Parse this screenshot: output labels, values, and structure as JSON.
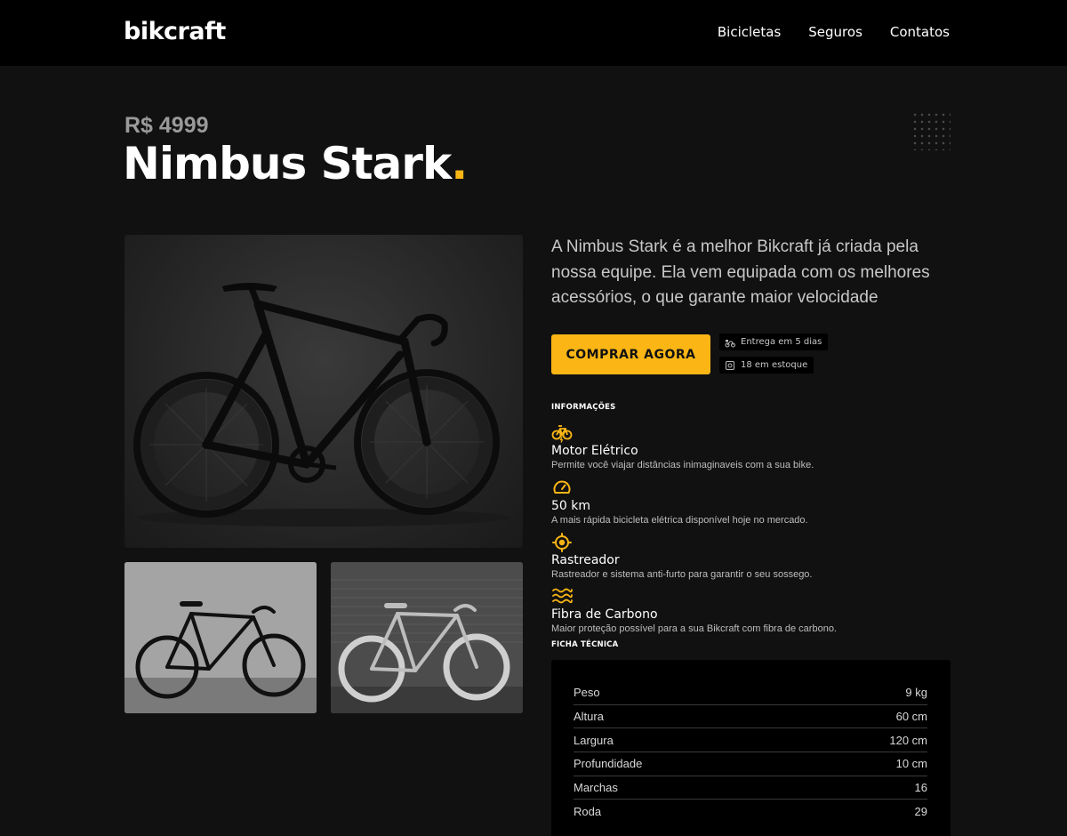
{
  "header": {
    "logo": "bikcraft",
    "nav": [
      "Bicicletas",
      "Seguros",
      "Contatos"
    ]
  },
  "product": {
    "price": "R$ 4999",
    "name": "Nimbus Stark",
    "name_dot": ".",
    "description": "A Nimbus Stark é a melhor Bikcraft já criada pela nossa equipe. Ela vem equipada com os melhores acessórios, o que garante maior velocidade",
    "buy_label": "COMPRAR AGORA",
    "delivery": "Entrega em 5 dias",
    "stock": "18 em estoque"
  },
  "info": {
    "label": "INFORMAÇÕES",
    "items": [
      {
        "icon": "bike-electric-icon",
        "name": "Motor Elétrico",
        "text": "Permite você viajar distâncias inimaginaveis com a sua bike."
      },
      {
        "icon": "speedometer-icon",
        "name": "50 km",
        "text": "A mais rápida bicicleta elétrica disponível hoje no mercado."
      },
      {
        "icon": "tracker-icon",
        "name": "Rastreador",
        "text": "Rastreador e sistema anti-furto para garantir o seu sossego."
      },
      {
        "icon": "carbon-fiber-icon",
        "name": "Fibra de Carbono",
        "text": "Maior proteção possível para a sua Bikcraft com fibra de carbono."
      }
    ]
  },
  "specs": {
    "label": "FICHA TÉCNICA",
    "rows": [
      {
        "label": "Peso",
        "value": "9 kg"
      },
      {
        "label": "Altura",
        "value": "60 cm"
      },
      {
        "label": "Largura",
        "value": "120 cm"
      },
      {
        "label": "Profundidade",
        "value": "10 cm"
      },
      {
        "label": "Marchas",
        "value": "16"
      },
      {
        "label": "Roda",
        "value": "29"
      }
    ]
  },
  "colors": {
    "accent": "#fbb615",
    "background": "#111111",
    "header": "#000000"
  }
}
